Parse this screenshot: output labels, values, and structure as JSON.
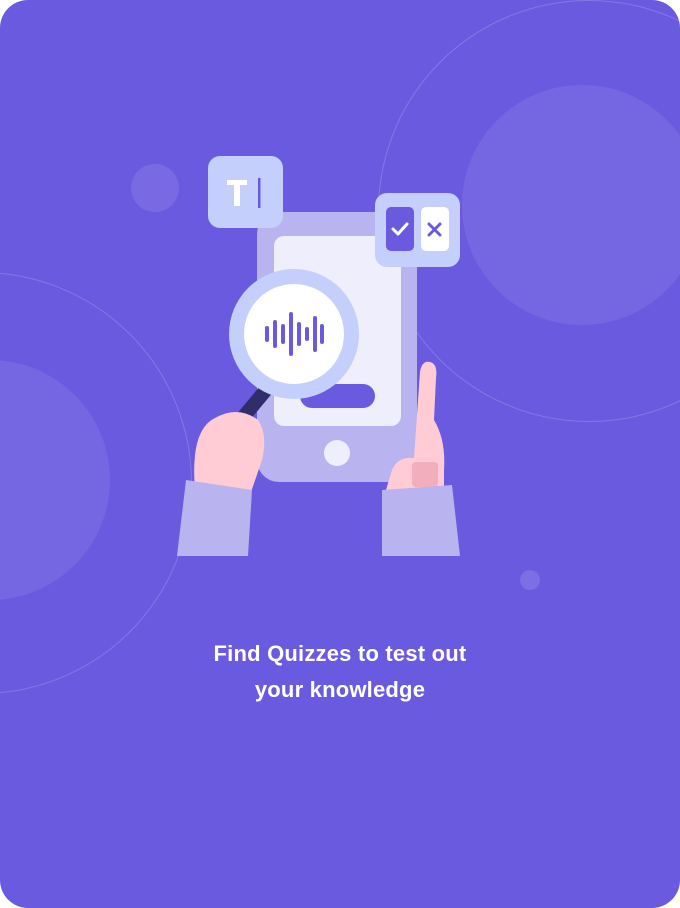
{
  "onboarding": {
    "headline_line1": "Find Quizzes to test out",
    "headline_line2": "your knowledge",
    "illustration": {
      "semantic": "hands-holding-phone-with-magnifier",
      "icons": [
        "text-cursor-icon",
        "check-icon",
        "close-icon",
        "sound-wave-icon",
        "home-button-icon"
      ]
    }
  },
  "colors": {
    "background": "#6A5AE0",
    "phone_body": "#B9B3F0",
    "phone_screen": "#EFEEFC",
    "magnifier_ring": "#C4D0FB",
    "accent": "#6A5AE0",
    "skin": "#FFCCD5",
    "sleeve": "#B9B3F0"
  }
}
